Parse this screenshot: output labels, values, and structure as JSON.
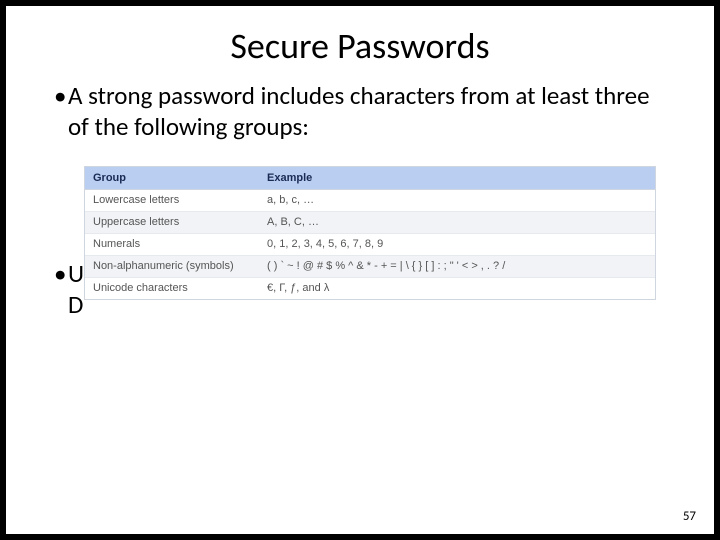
{
  "slide": {
    "title": "Secure Passwords",
    "bullet1_dot": "•",
    "bullet1_text": "A strong password includes characters from at least three of the following groups:",
    "bullet2_dot": "•",
    "bullet2_line1": "U",
    "bullet2_line2": "D",
    "page_number": "57"
  },
  "table": {
    "head_group": "Group",
    "head_example": "Example",
    "rows": [
      {
        "group": "Lowercase letters",
        "example": "a, b, c, …"
      },
      {
        "group": "Uppercase letters",
        "example": "A, B, C, …"
      },
      {
        "group": "Numerals",
        "example": "0, 1, 2, 3, 4, 5, 6, 7, 8, 9"
      },
      {
        "group": "Non-alphanumeric (symbols)",
        "example": "( ) ` ~ ! @ # $ % ^ & * - + = | \\ { } [ ] : ; \" ' < > , . ? /"
      },
      {
        "group": "Unicode characters",
        "example": "€, Γ, ƒ, and λ"
      }
    ]
  }
}
